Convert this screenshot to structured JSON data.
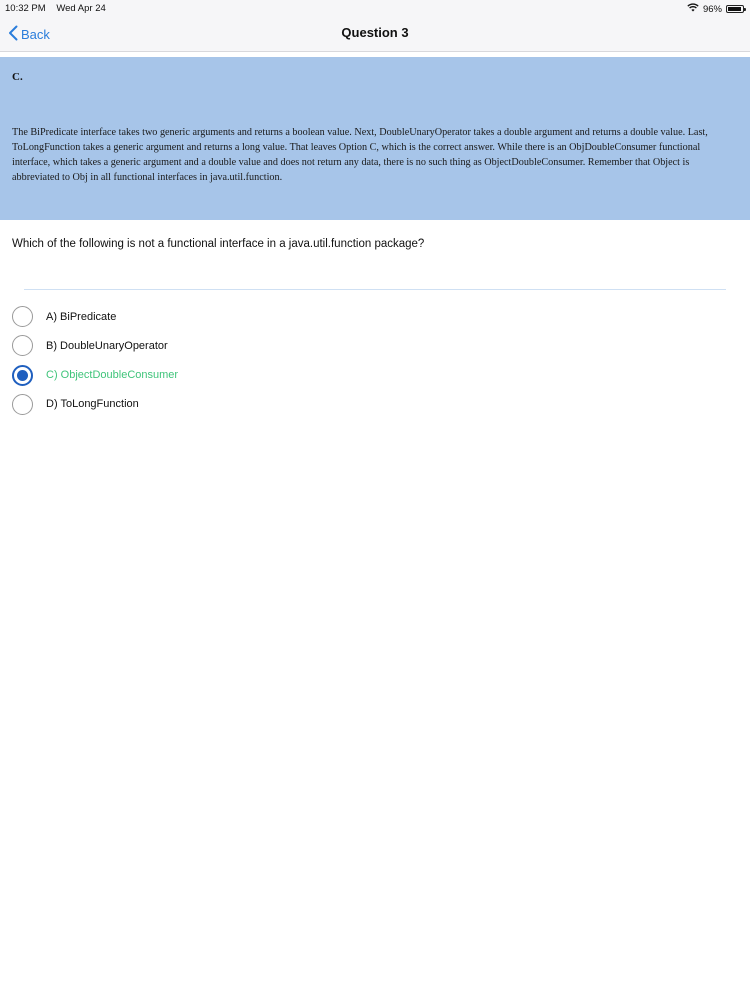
{
  "status_bar": {
    "time": "10:32 PM",
    "date": "Wed Apr 24",
    "battery": "96%",
    "battery_level": 0.96
  },
  "nav": {
    "back_label": "Back",
    "title": "Question 3"
  },
  "answer": {
    "letter": "C.",
    "explanation": "The BiPredicate interface takes two generic arguments and returns a boolean value. Next, DoubleUnaryOperator takes a double argument and returns a double value. Last, ToLongFunction takes a generic argument and returns a long value. That leaves Option C, which is the correct answer. While there is an ObjDoubleConsumer functional interface, which takes a generic argument and a double value and does not return any data, there is no such thing as ObjectDoubleConsumer. Remember that Object is abbreviated to Obj in all functional interfaces in java.util.function."
  },
  "question": {
    "text": "Which of the following is not a functional interface in a java.util.function package?"
  },
  "options": [
    {
      "label": "A) BiPredicate",
      "selected": false,
      "correct": false
    },
    {
      "label": "B) DoubleUnaryOperator",
      "selected": false,
      "correct": false
    },
    {
      "label": "C) ObjectDoubleConsumer",
      "selected": true,
      "correct": true
    },
    {
      "label": "D) ToLongFunction",
      "selected": false,
      "correct": false
    }
  ],
  "colors": {
    "accent": "#2a7ddb",
    "panel": "#a7c5e9",
    "correct": "#3fc47a",
    "radio_selected": "#1f5fbf"
  },
  "icons": {
    "back": "chevron-left-icon",
    "wifi": "wifi-icon",
    "battery": "battery-icon"
  }
}
